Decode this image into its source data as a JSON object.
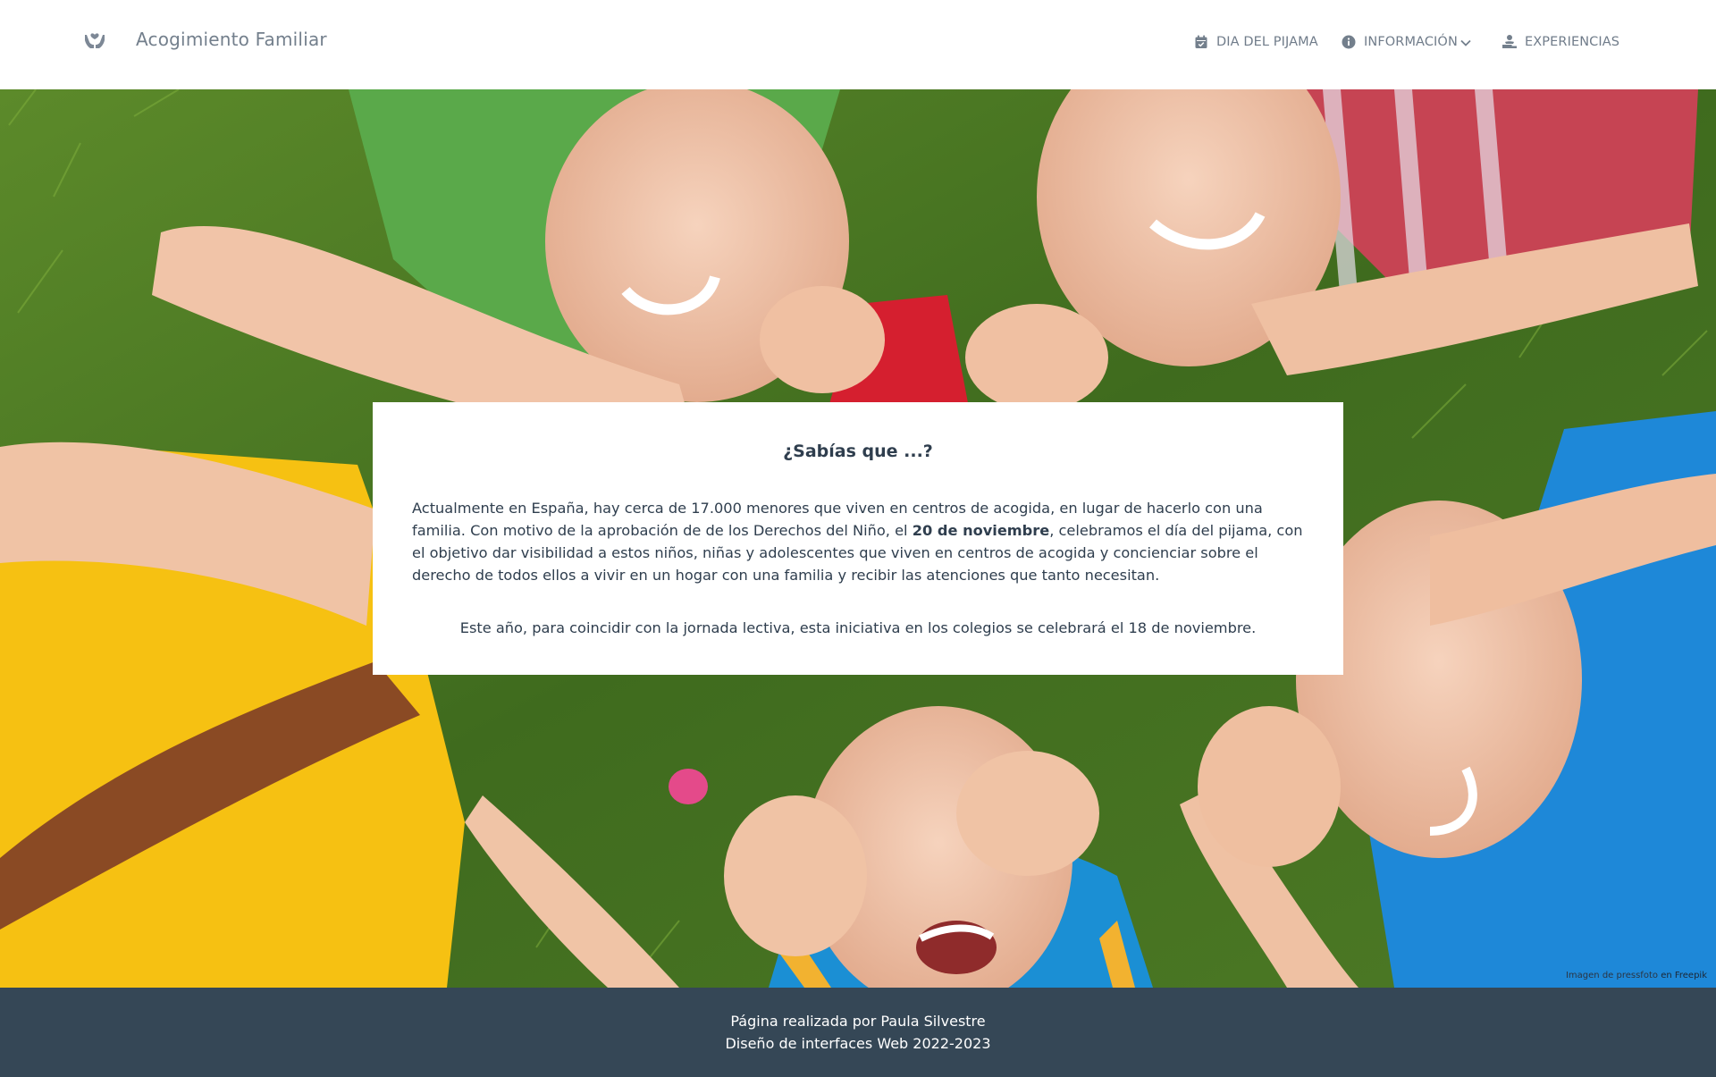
{
  "header": {
    "brand": {
      "name": "Acogimiento Familiar",
      "logo_icon": "hands-heart-icon"
    },
    "nav": [
      {
        "label": "DIA DEL PIJAMA",
        "icon": "calendar-icon"
      },
      {
        "label": "INFORMACIÓN",
        "icon": "info-circle-icon",
        "dropdown": true
      },
      {
        "label": "EXPERIENCIAS",
        "icon": "person-hands-icon"
      }
    ]
  },
  "card": {
    "title": "¿Sabías que ...?",
    "paragraph1_part1": "Actualmente en España, hay cerca de 17.000 menores que viven en centros de acogida, en lugar de hacerlo con una familia. Con motivo de la aprobación de de los Derechos del Niño, el ",
    "paragraph1_bold": "20 de noviembre",
    "paragraph1_part2": ", celebramos el día del pijama, con el objetivo dar visibilidad a estos niños, niñas y adolescentes que viven en centros de acogida y concienciar sobre el derecho de todos ellos a vivir en un hogar con una familia y recibir las atenciones que tanto necesitan.",
    "paragraph2": "Este año, para coincidir con la jornada lectiva, esta iniciativa en los colegios se celebrará el 18 de noviembre."
  },
  "photo_credit": {
    "prefix": "Imagen de pressfoto",
    "link": "en Freepik"
  },
  "footer": {
    "line1": "Página realizada por Paula Silvestre",
    "line2": "Diseño de interfaces Web 2022-2023"
  },
  "colors": {
    "navbar_bg": "#ffffff",
    "nav_text": "#707c8a",
    "footer_bg": "#354756",
    "card_text": "#2f3e4e"
  }
}
